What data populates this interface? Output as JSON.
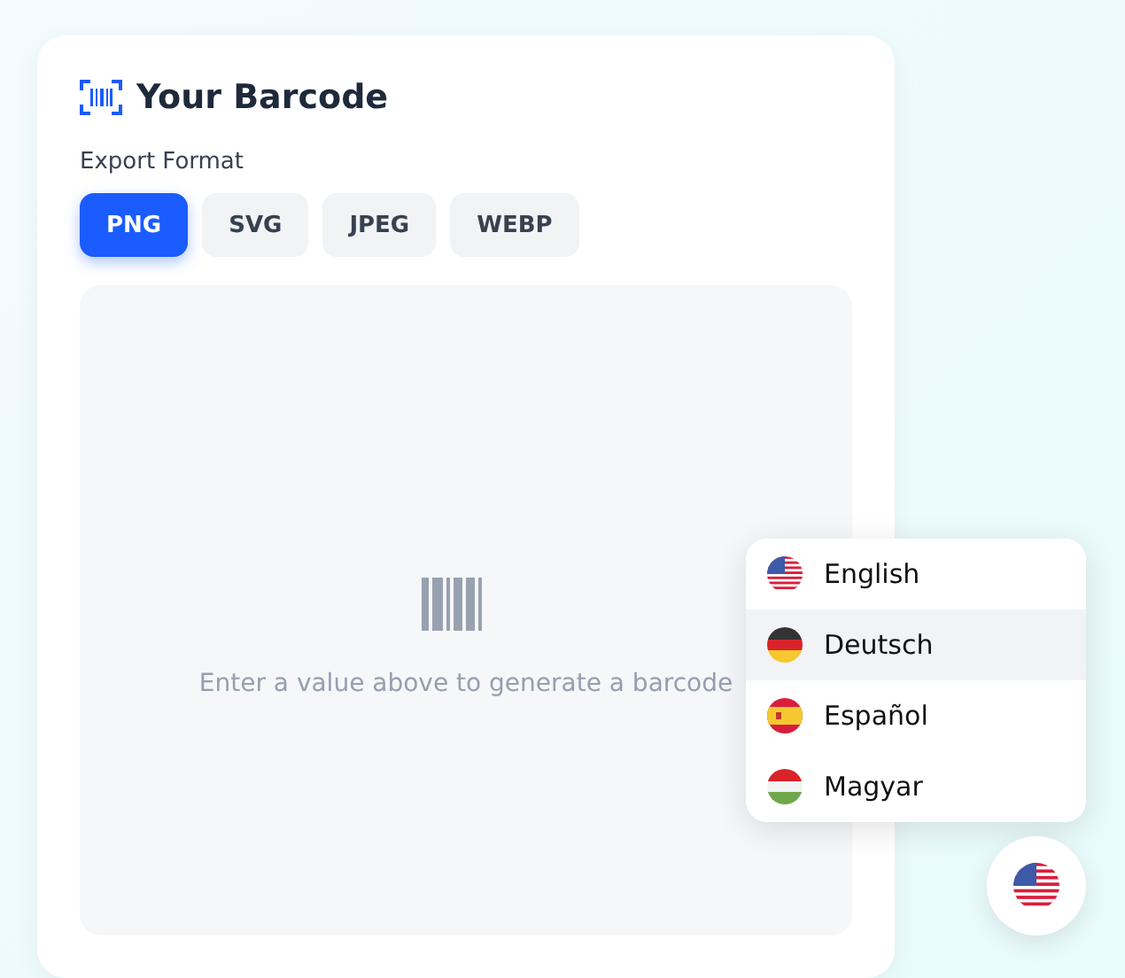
{
  "card": {
    "title": "Your Barcode",
    "format_label": "Export Format",
    "formats": [
      {
        "label": "PNG",
        "selected": true
      },
      {
        "label": "SVG",
        "selected": false
      },
      {
        "label": "JPEG",
        "selected": false
      },
      {
        "label": "WEBP",
        "selected": false
      }
    ],
    "preview": {
      "message": "Enter a value above to generate a barcode"
    }
  },
  "language_menu": {
    "items": [
      {
        "label": "English",
        "kind": "us",
        "hovered": false
      },
      {
        "label": "Deutsch",
        "kind": "de",
        "hovered": true
      },
      {
        "label": "Español",
        "kind": "es",
        "hovered": false
      },
      {
        "label": "Magyar",
        "kind": "hu",
        "hovered": false
      }
    ]
  },
  "language_button": {
    "kind": "us"
  }
}
